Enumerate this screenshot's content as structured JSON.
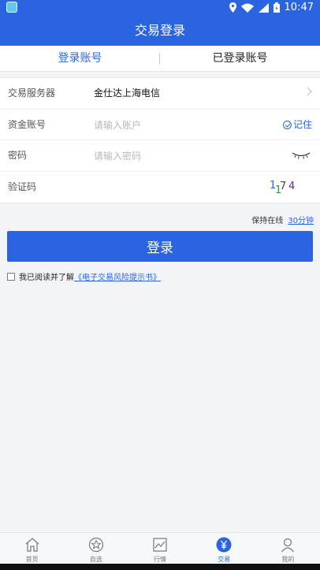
{
  "status_bar": {
    "time": "10:47"
  },
  "header": {
    "title": "交易登录"
  },
  "tabs": [
    {
      "label": "登录账号",
      "active": true
    },
    {
      "label": "已登录账号",
      "active": false
    }
  ],
  "form": {
    "server": {
      "label": "交易服务器",
      "value": "金仕达上海电信"
    },
    "account": {
      "label": "资金账号",
      "placeholder": "请输入账户",
      "remember_label": "记住"
    },
    "password": {
      "label": "密码",
      "placeholder": "请输入密码"
    },
    "captcha": {
      "label": "验证码",
      "code": [
        "1",
        "1",
        "7",
        "4"
      ]
    }
  },
  "keep_online": {
    "label": "保持在线",
    "duration": "30分钟"
  },
  "login_button": {
    "label": "登录"
  },
  "agreement": {
    "text": "我已阅读并了解",
    "link": "《电子交易风险提示书》"
  },
  "bottom_nav": [
    {
      "label": "首页",
      "icon": "home-icon"
    },
    {
      "label": "自选",
      "icon": "star-icon"
    },
    {
      "label": "行情",
      "icon": "chart-icon"
    },
    {
      "label": "交易",
      "icon": "yen-icon",
      "active": true
    },
    {
      "label": "我的",
      "icon": "user-icon"
    }
  ],
  "colors": {
    "brand": "#2a64e0"
  }
}
